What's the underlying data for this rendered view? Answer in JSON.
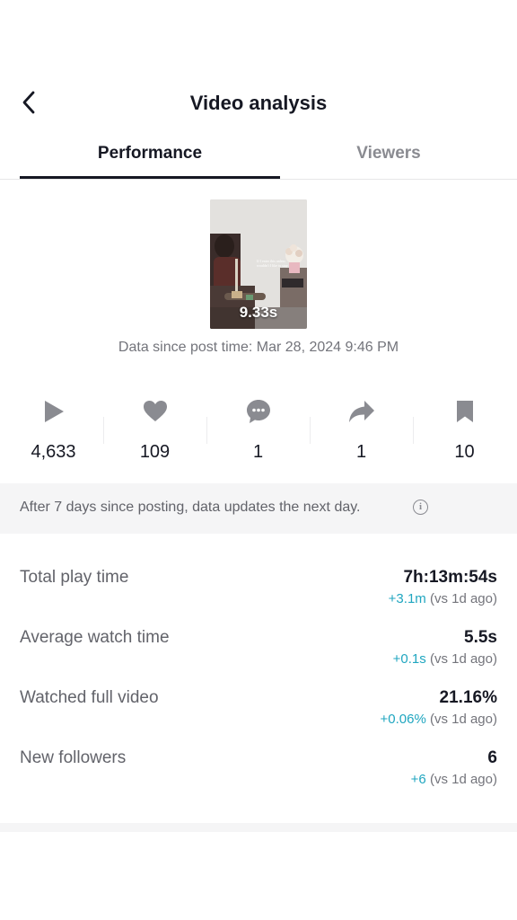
{
  "header": {
    "title": "Video analysis",
    "back_icon": "chevron-left-icon"
  },
  "tabs": [
    {
      "label": "Performance",
      "active": true
    },
    {
      "label": "Viewers",
      "active": false
    }
  ],
  "video": {
    "duration": "9.33s"
  },
  "data_since": "Data since post time: Mar 28, 2024 9:46 PM",
  "stats": [
    {
      "icon": "play-icon",
      "value": "4,633"
    },
    {
      "icon": "heart-icon",
      "value": "109"
    },
    {
      "icon": "comment-icon",
      "value": "1"
    },
    {
      "icon": "share-icon",
      "value": "1"
    },
    {
      "icon": "bookmark-icon",
      "value": "10"
    }
  ],
  "notice": {
    "text": "After 7 days since posting, data updates the next day.",
    "icon": "info-icon"
  },
  "metrics": [
    {
      "label": "Total play time",
      "value": "7h:13m:54s",
      "delta": "+3.1m",
      "compare": "(vs 1d ago)"
    },
    {
      "label": "Average watch time",
      "value": "5.5s",
      "delta": "+0.1s",
      "compare": "(vs 1d ago)"
    },
    {
      "label": "Watched full video",
      "value": "21.16%",
      "delta": "+0.06%",
      "compare": "(vs 1d ago)"
    },
    {
      "label": "New followers",
      "value": "6",
      "delta": "+6",
      "compare": "(vs 1d ago)"
    }
  ],
  "colors": {
    "text_primary": "#161823",
    "text_secondary": "#62636a",
    "icon_gray": "#8a8b91",
    "delta_accent": "#20a6c0",
    "notice_bg": "#f5f5f6"
  }
}
